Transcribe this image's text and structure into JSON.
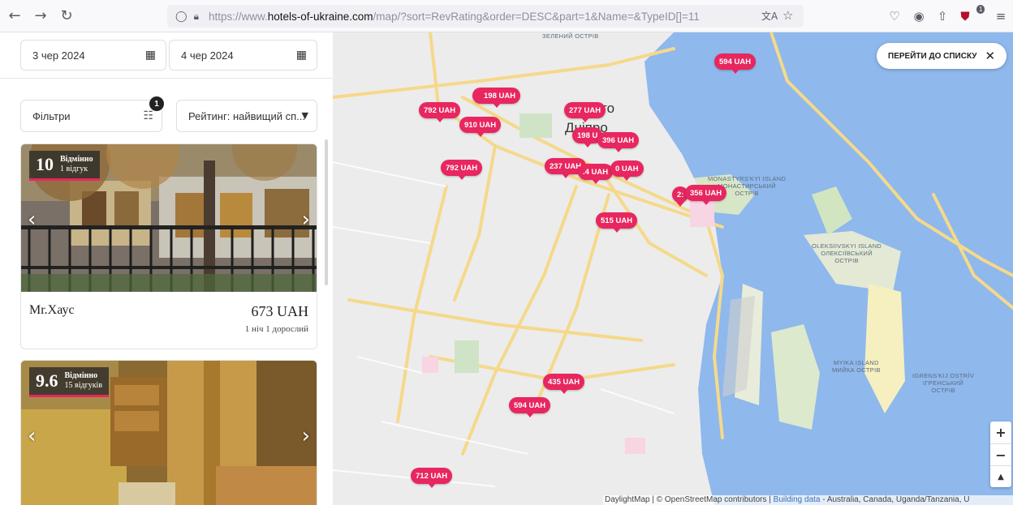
{
  "browser": {
    "url_prefix": "https://www.",
    "url_domain": "hotels-of-ukraine.com",
    "url_path": "/map/?sort=RevRating&order=DESC&part=1&Name=&TypeID[]=11",
    "extension_badge": "1"
  },
  "search": {
    "date_from": "3 чер 2024",
    "date_to": "4 чер 2024",
    "filters_label": "Фільтри",
    "filters_count": "1",
    "sort_label": "Рейтинг: найвищий сп..."
  },
  "hotels": [
    {
      "rating": "10",
      "rating_label": "Відмінно",
      "reviews": "1 відгук",
      "name": "Mr.Хаус",
      "price": "673 UAH",
      "meta": "1 ніч 1 дорослий"
    },
    {
      "rating": "9.6",
      "rating_label": "Відмінно",
      "reviews": "15 відгуків"
    }
  ],
  "map": {
    "list_button": "ПЕРЕЙТИ ДО СПИСКУ",
    "city_label": "Дніпро",
    "city_label_partial": "то",
    "islands": {
      "monastyrskyi": "MONASTYRS'KYI ISLAND\nМОНАСТИРСЬКИЙ\nОСТРІВ",
      "oleksiivskyi": "OLEKSIIVSKYI ISLAND\nОЛЕКСІЇВСЬКИЙ\nОСТРІВ",
      "myika": "MYIKA ISLAND\nМИЙКА ОСТРІВ",
      "ihrenskyi": "IGRENS'KIJ OSTRÍV\nІГРЕНСЬКИЙ\nОСТРІВ",
      "zelenyi": "ЗЕЛЕНИЙ ОСТРІВ"
    },
    "pins": [
      "594 UAH",
      "198 UAH",
      "792 UAH",
      "910 UAH",
      "277 UAH",
      "198 U",
      "396 UAH",
      "792 UAH",
      "237 UAH",
      ".4 UAH",
      "0 UAH",
      "2:",
      "356 UAH",
      "515 UAH",
      "435 UAH",
      "594 UAH",
      "712 UAH"
    ],
    "zoom_in": "+",
    "zoom_out": "−",
    "north": "▲",
    "attribution_1": "DaylightMap | © OpenStreetMap contributors | ",
    "attribution_link": "Building data",
    "attribution_2": " - Australia, Canada, Uganda/Tanzania, U"
  },
  "colors": {
    "accent": "#e8265f",
    "water": "#8fb8ec",
    "road": "#f5d98a"
  }
}
